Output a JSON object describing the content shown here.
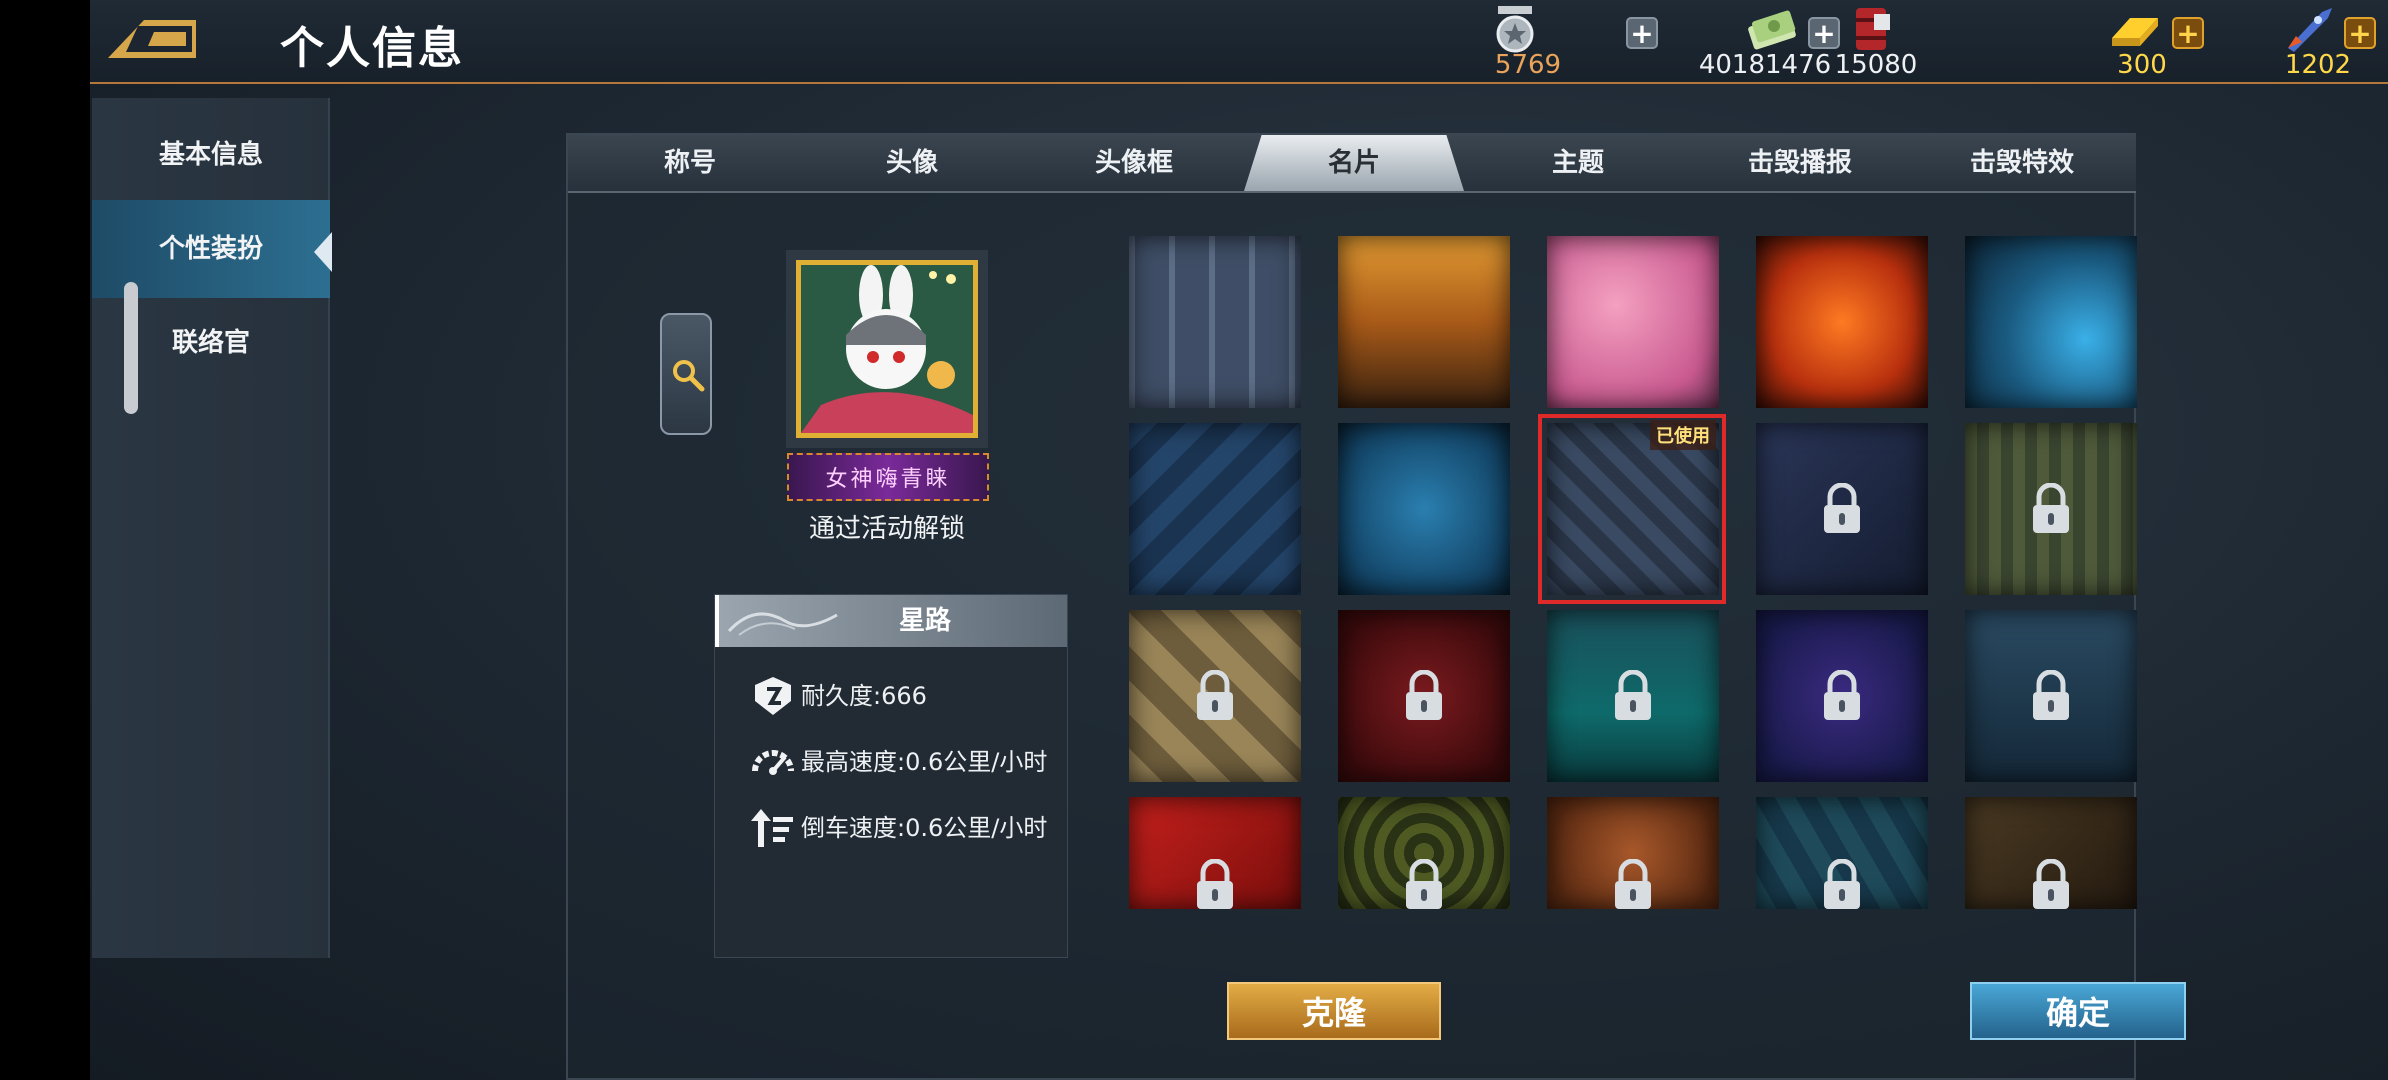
{
  "header": {
    "title": "个人信息",
    "resources": [
      {
        "icon": "medal-icon",
        "value": "5769",
        "color": "#e9a35a",
        "plus": "grey"
      },
      {
        "icon": "cash-icon",
        "value": "40181476",
        "color": "#eef1f4",
        "plus": "grey"
      },
      {
        "icon": "oil-barrel-icon",
        "value": "15080",
        "color": "#eef1f4",
        "plus": ""
      },
      {
        "icon": "gold-bar-icon",
        "value": "300",
        "color": "#ffd84a",
        "plus": "gold"
      },
      {
        "icon": "rocket-icon",
        "value": "1202",
        "color": "#ffd84a",
        "plus": "gold"
      }
    ],
    "plus_label": "+"
  },
  "sidebar": {
    "items": [
      {
        "label": "基本信息",
        "active": false
      },
      {
        "label": "个性装扮",
        "active": true
      },
      {
        "label": "联络官",
        "active": false
      }
    ]
  },
  "tabs": [
    "称号",
    "头像",
    "头像框",
    "名片",
    "主题",
    "击毁播报",
    "击毁特效"
  ],
  "active_tab": "名片",
  "preview": {
    "tag_text": "女神嗨青睐",
    "unlock_text": "通过活动解锁"
  },
  "card_info": {
    "name": "星路",
    "stats": [
      {
        "icon": "durability-icon",
        "text": "耐久度:666"
      },
      {
        "icon": "speedometer-icon",
        "text": "最高速度:0.6公里/小时"
      },
      {
        "icon": "reverse-arrow-icon",
        "text": "倒车速度:0.6公里/小时"
      }
    ]
  },
  "cards": [
    {
      "theme": "blue-pattern",
      "locked": false
    },
    {
      "theme": "sunset",
      "locked": false
    },
    {
      "theme": "pink-hearts",
      "locked": false
    },
    {
      "theme": "fire",
      "locked": false
    },
    {
      "theme": "hexagon-blue",
      "locked": false
    },
    {
      "theme": "blue-stripes",
      "locked": false
    },
    {
      "theme": "blue-floral",
      "locked": false
    },
    {
      "theme": "stars-shuriken",
      "locked": false,
      "used": true
    },
    {
      "theme": "navy-star",
      "locked": true
    },
    {
      "theme": "camo-green",
      "locked": true
    },
    {
      "theme": "tan-argyle",
      "locked": true
    },
    {
      "theme": "dark-red",
      "locked": true
    },
    {
      "theme": "teal-sea",
      "locked": true
    },
    {
      "theme": "purple-night",
      "locked": true
    },
    {
      "theme": "heli-navy",
      "locked": true
    },
    {
      "theme": "red-flag",
      "locked": true
    },
    {
      "theme": "green-ornate",
      "locked": true
    },
    {
      "theme": "autumn-leaves",
      "locked": true
    },
    {
      "theme": "teal-leaves",
      "locked": true
    },
    {
      "theme": "dark-gold-star",
      "locked": true
    }
  ],
  "used_badge": "已使用",
  "buttons": {
    "clone": "克隆",
    "confirm": "确定"
  }
}
